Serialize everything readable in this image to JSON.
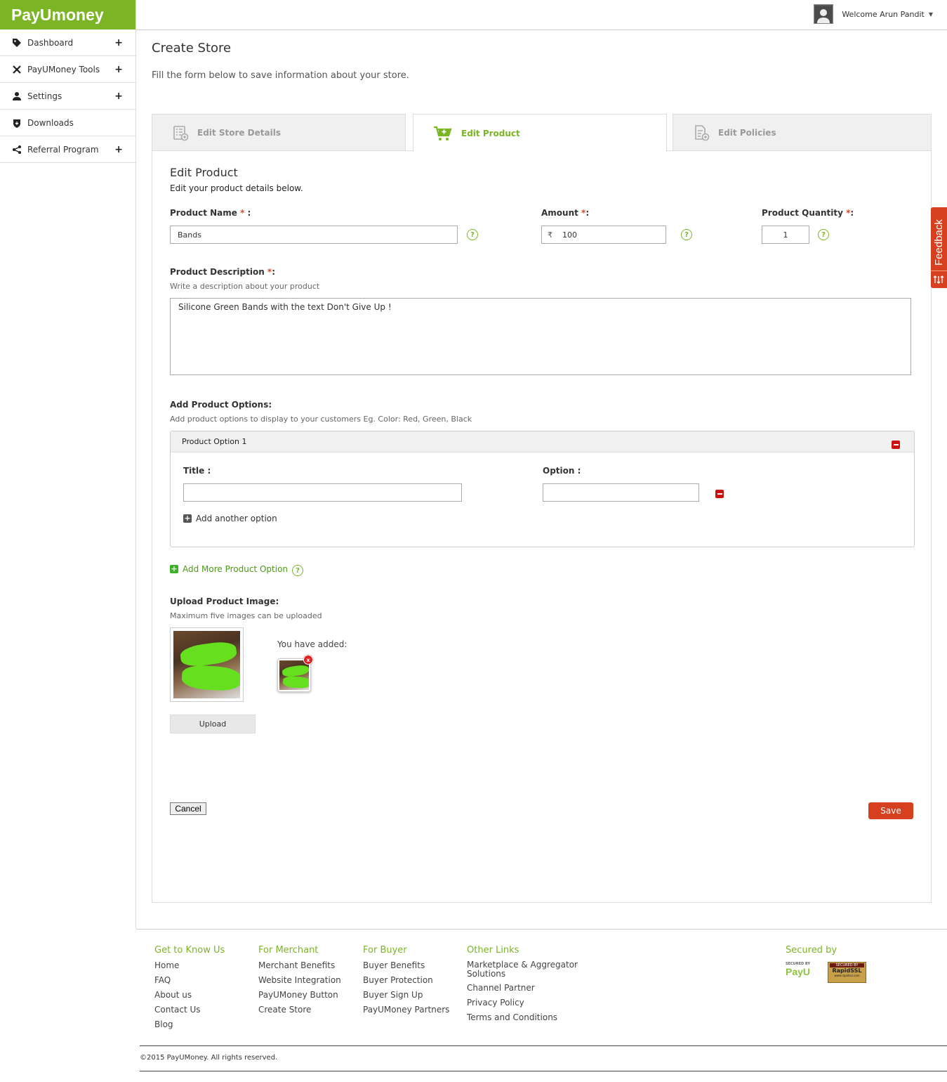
{
  "app": {
    "logo_text": "PayUmoney",
    "brand_color": "#7bb526",
    "accent_color": "#d6401f"
  },
  "sidebar": {
    "items": [
      {
        "label": "Dashboard",
        "icon": "tag-icon",
        "expandable": true
      },
      {
        "label": "PayUMoney Tools",
        "icon": "tools-icon",
        "expandable": true
      },
      {
        "label": "Settings",
        "icon": "user-icon",
        "expandable": true
      },
      {
        "label": "Downloads",
        "icon": "shield-icon",
        "expandable": false
      },
      {
        "label": "Referral Program",
        "icon": "share-icon",
        "expandable": true
      }
    ],
    "expand_symbol": "+"
  },
  "header": {
    "welcome": "Welcome Arun Pandit"
  },
  "page": {
    "title": "Create Store",
    "subtitle": "Fill the form below to save information about your store."
  },
  "tabs": [
    {
      "label": "Edit Store Details",
      "active": false
    },
    {
      "label": "Edit Product",
      "active": true
    },
    {
      "label": "Edit Policies",
      "active": false
    }
  ],
  "form": {
    "section_title": "Edit Product",
    "section_subtitle": "Edit your product details below.",
    "product_name": {
      "label": "Product Name",
      "required_mark": "*",
      "suffix": " :",
      "value": "Bands"
    },
    "amount": {
      "label": "Amount",
      "required_mark": "*",
      "suffix": ":",
      "currency": "₹",
      "value": "100"
    },
    "quantity": {
      "label": "Product Quantity",
      "required_mark": "*",
      "suffix": ":",
      "value": "1"
    },
    "description": {
      "label": "Product Description",
      "required_mark": "*",
      "suffix": ":",
      "hint": "Write a description about your product",
      "value": "Silicone Green Bands with the text Don't Give Up !"
    },
    "options": {
      "label": "Add Product Options:",
      "hint": "Add product options to display to your customers Eg. Color: Red, Green, Black",
      "box_title": "Product Option 1",
      "title_label": "Title :",
      "title_value": "",
      "option_label": "Option :",
      "option_value": "",
      "add_another": "Add another option",
      "add_more": "Add More Product Option"
    },
    "upload": {
      "label": "Upload Product Image:",
      "hint": "Maximum five images can be uploaded",
      "added_label": "You have added:",
      "button": "Upload"
    },
    "help_symbol": "?",
    "remove_symbol": "x",
    "cancel": "Cancel",
    "save": "Save"
  },
  "feedback": {
    "label": "Feedback"
  },
  "footer": {
    "columns": [
      {
        "heading": "Get to Know Us",
        "links": [
          "Home",
          "FAQ",
          "About us",
          "Contact Us",
          "Blog"
        ]
      },
      {
        "heading": "For Merchant",
        "links": [
          "Merchant Benefits",
          "Website Integration",
          "PayUMoney Button",
          "Create Store"
        ]
      },
      {
        "heading": "For Buyer",
        "links": [
          "Buyer Benefits",
          "Buyer Protection",
          "Buyer Sign Up",
          "PayUMoney Partners"
        ]
      },
      {
        "heading": "Other Links",
        "links": [
          "Marketplace & Aggregator Solutions",
          "Channel Partner",
          "Privacy Policy",
          "Terms and Conditions"
        ]
      }
    ],
    "secured_by": "Secured by",
    "badges": {
      "payu_top": "SECURED BY",
      "payu_name": "PayU",
      "ssl_top": "SECURED BY",
      "ssl_name": "RapidSSL",
      "ssl_url": "www.rapidssl.com"
    },
    "copyright": "©2015 PayUMoney. All rights reserved."
  }
}
